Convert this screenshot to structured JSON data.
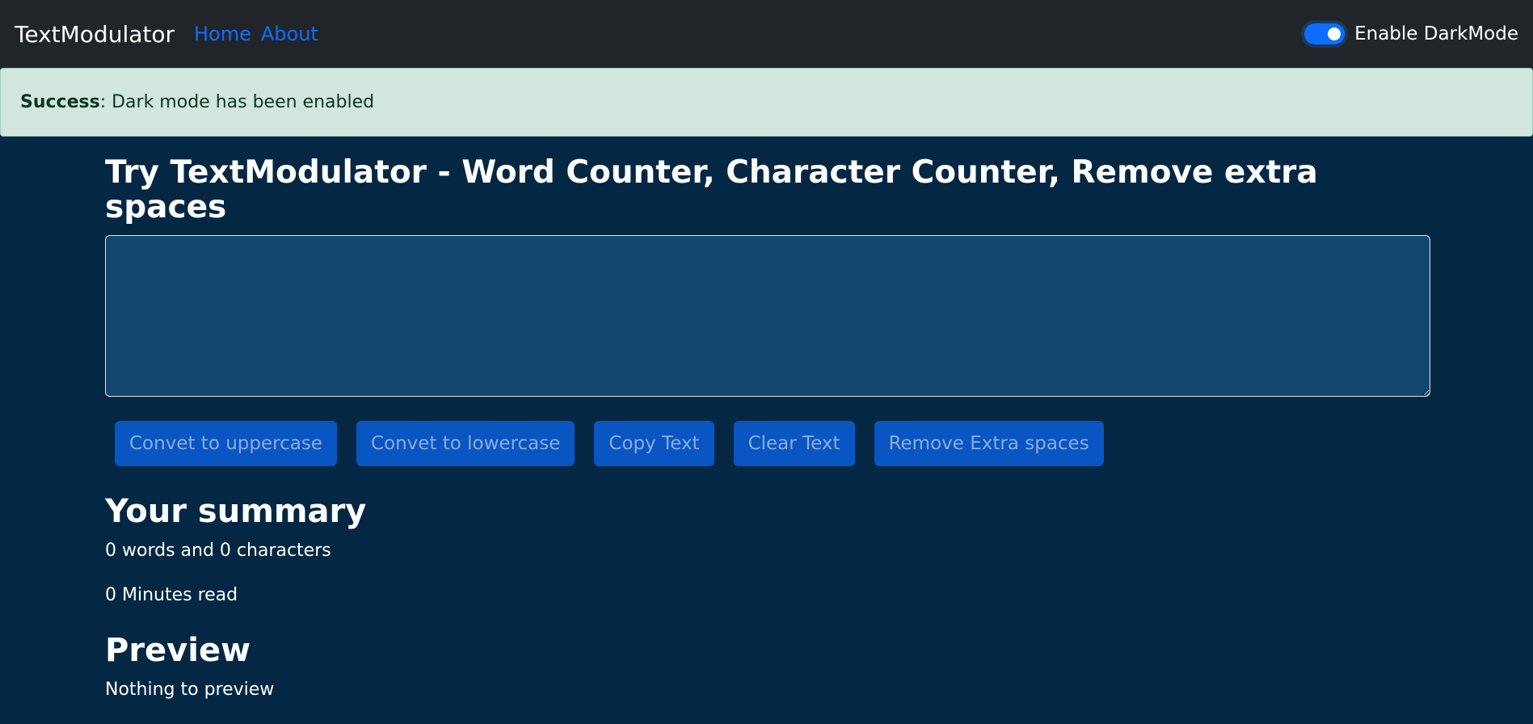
{
  "navbar": {
    "brand": "TextModulator",
    "links": [
      "Home",
      "About"
    ],
    "dark_mode_label": "Enable DarkMode"
  },
  "alert": {
    "type": "Success",
    "message": ": Dark mode has been enabled"
  },
  "main": {
    "title": "Try TextModulator - Word Counter, Character Counter, Remove extra spaces",
    "textarea_value": "",
    "buttons": [
      "Convet to uppercase",
      "Convet to lowercase",
      "Copy Text",
      "Clear Text",
      "Remove Extra spaces"
    ],
    "summary_heading": "Your summary",
    "summary_counts": "0 words and 0 characters",
    "summary_read": "0 Minutes read",
    "preview_heading": "Preview",
    "preview_text": "Nothing to preview"
  },
  "colors": {
    "navbar_bg": "#212529",
    "page_bg": "#042743",
    "textarea_bg": "#13466e",
    "accent": "#0d6efd",
    "alert_bg": "#d1e7dd"
  }
}
